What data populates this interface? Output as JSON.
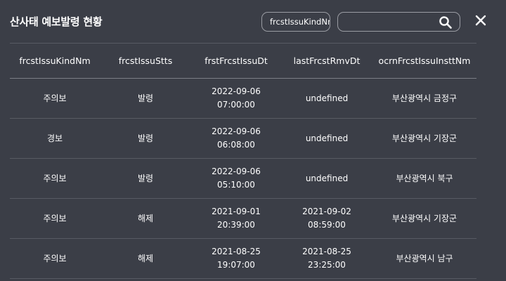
{
  "header": {
    "title": "산사태 예보발령 현황",
    "kind_select_value": "frcstIssuKindNm",
    "search_value": ""
  },
  "table": {
    "columns": [
      "frcstIssuKindNm",
      "frcstIssuStts",
      "frstFrcstIssuDt",
      "lastFrcstRmvDt",
      "ocrnFrcstIssuInsttNm"
    ],
    "rows": [
      {
        "kind": "주의보",
        "status": "발령",
        "first_date": "2022-09-06",
        "first_time": "07:00:00",
        "last_date": "undefined",
        "last_time": "",
        "inst": "부산광역시 금정구"
      },
      {
        "kind": "경보",
        "status": "발령",
        "first_date": "2022-09-06",
        "first_time": "06:08:00",
        "last_date": "undefined",
        "last_time": "",
        "inst": "부산광역시 기장군"
      },
      {
        "kind": "주의보",
        "status": "발령",
        "first_date": "2022-09-06",
        "first_time": "05:10:00",
        "last_date": "undefined",
        "last_time": "",
        "inst": "부산광역시 북구"
      },
      {
        "kind": "주의보",
        "status": "해제",
        "first_date": "2021-09-01",
        "first_time": "20:39:00",
        "last_date": "2021-09-02",
        "last_time": "08:59:00",
        "inst": "부산광역시 기장군"
      },
      {
        "kind": "주의보",
        "status": "해제",
        "first_date": "2021-08-25",
        "first_time": "19:07:00",
        "last_date": "2021-08-25",
        "last_time": "23:25:00",
        "inst": "부산광역시 남구"
      }
    ]
  },
  "icons": {
    "search": "search-icon",
    "close": "close-icon"
  },
  "colors": {
    "background": "#3b3e47",
    "divider": "#585b63",
    "text": "#ffffff"
  }
}
